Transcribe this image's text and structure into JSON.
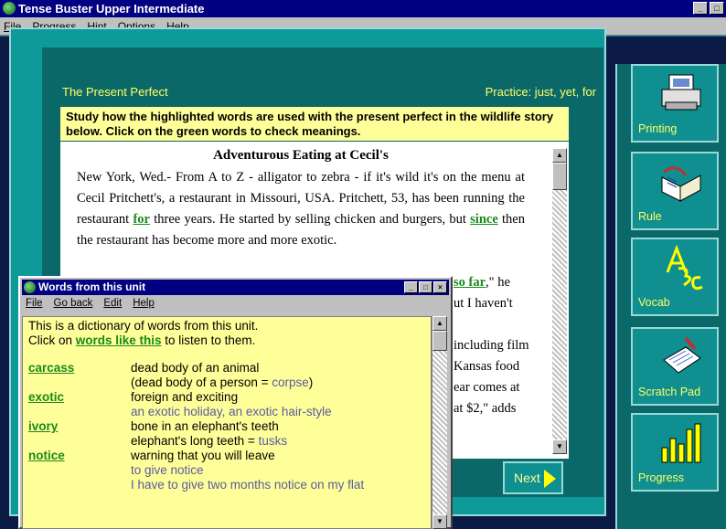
{
  "app": {
    "title": "Tense Buster Upper Intermediate"
  },
  "menu": [
    "File",
    "Progress",
    "Hint",
    "Options",
    "Help"
  ],
  "window_buttons": [
    "_",
    "□",
    "×"
  ],
  "lesson": {
    "section": "The Present Perfect",
    "practice": "Practice: just, yet, for",
    "instructions": "Study how the highlighted words are used with the present perfect in the wildlife story below. Click on the green words to check meanings."
  },
  "story": {
    "title": "Adventurous Eating at Cecil's",
    "p1_a": "New York, Wed.- From A to Z - alligator to zebra - if it's wild it's on the menu at Cecil Pritchett's, a restaurant in Missouri, USA. Pritchett, 53, has been running the restaurant ",
    "p1_link1": "for",
    "p1_b": " three years. He started by selling chicken and burgers, but ",
    "p1_link2": "since",
    "p1_c": " then the restaurant has become more and more exotic.",
    "frag_link": "so far",
    "frag1": ",\" he",
    "frag2": "ut I haven't",
    "frag3": "including film",
    "frag4": "Kansas food",
    "frag5": "ear comes at",
    "frag6": "at $2,\" adds"
  },
  "next_label": "Next",
  "tools": [
    {
      "label": "Printing",
      "icon": "printer-icon"
    },
    {
      "label": "Rule",
      "icon": "book-icon"
    },
    {
      "label": "Vocab",
      "icon": "abc-icon"
    },
    {
      "label": "Scratch Pad",
      "icon": "notepad-icon"
    },
    {
      "label": "Progress",
      "icon": "bar-chart-icon"
    }
  ],
  "dictionary": {
    "title": "Words from this unit",
    "menu": [
      "File",
      "Go back",
      "Edit",
      "Help"
    ],
    "intro1": "This is a dictionary of words from this unit.",
    "intro2a": "Click on ",
    "intro2_link": "words like this",
    "intro2b": " to listen to them.",
    "entries": [
      {
        "word": "carcass",
        "lines": [
          {
            "text": "dead body of an animal"
          },
          {
            "text": "(dead body of a person = ",
            "extra": "corpse",
            "tail": ")"
          }
        ]
      },
      {
        "word": "exotic",
        "lines": [
          {
            "text": "foreign and exciting"
          },
          {
            "text": "an exotic holiday, an exotic hair-style",
            "example": true
          }
        ]
      },
      {
        "word": "ivory",
        "lines": [
          {
            "text": "bone in an elephant's teeth"
          },
          {
            "text": "elephant's long teeth = ",
            "extra": "tusks"
          }
        ]
      },
      {
        "word": "notice",
        "lines": [
          {
            "text": "warning that you will leave"
          },
          {
            "text": "to give notice",
            "example": true
          },
          {
            "text": "I have to give two months notice on my flat",
            "example": true
          }
        ]
      }
    ]
  },
  "colors": {
    "desktop": "#0c1a46",
    "teal": "#0f9a9a",
    "highlight": "#ffff99",
    "link_green": "#1a8a1a"
  }
}
